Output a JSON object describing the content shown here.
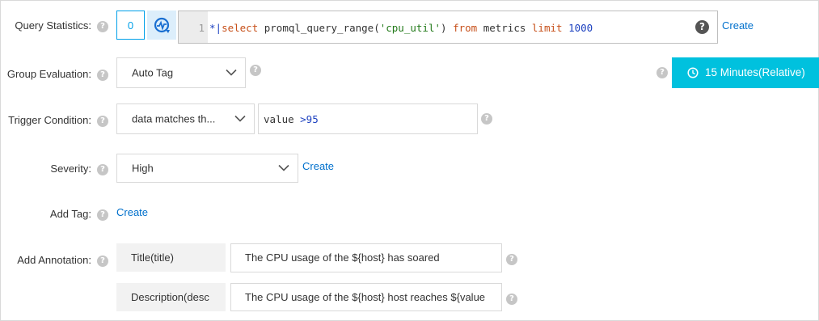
{
  "labels": {
    "query_statistics": "Query Statistics:",
    "group_evaluation": "Group Evaluation:",
    "trigger_condition": "Trigger Condition:",
    "severity": "Severity:",
    "add_tag": "Add Tag:",
    "add_annotation": "Add Annotation:"
  },
  "help_glyph": "?",
  "query": {
    "count": "0",
    "line_number": "1",
    "prefix": "*|",
    "kw_select": "select",
    "func_open": " promql_query_range(",
    "arg": "'cpu_util'",
    "func_close": ") ",
    "kw_from": "from",
    "table": " metrics ",
    "kw_limit": "limit",
    "space": " ",
    "limit_value": "1000",
    "create_link": "Create"
  },
  "group_evaluation": {
    "selected": "Auto Tag"
  },
  "time_range": {
    "label": "15 Minutes(Relative)",
    "accent": "#00c1de"
  },
  "trigger_condition": {
    "selected": "data matches th...",
    "expr_field": "value ",
    "expr_op": ">95"
  },
  "severity": {
    "selected": "High",
    "create_link": "Create"
  },
  "add_tag": {
    "create_link": "Create"
  },
  "annotations": [
    {
      "key": "Title(title)",
      "value": "The CPU usage of the ${host} has soared"
    },
    {
      "key": "Description(desc",
      "value": "The CPU usage of the ${host} host reaches ${value"
    }
  ]
}
